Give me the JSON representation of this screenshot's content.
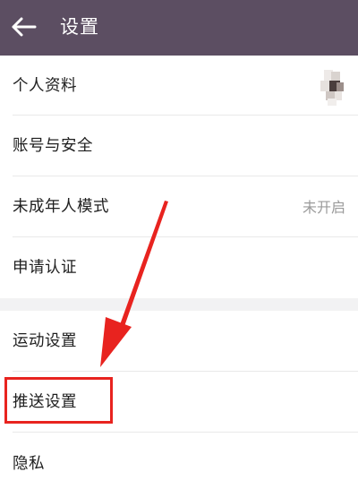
{
  "header": {
    "title": "设置",
    "back_icon": "arrow-left-icon",
    "background": "#5c4e62"
  },
  "menu": {
    "profile": {
      "label": "个人资料"
    },
    "account_security": {
      "label": "账号与安全"
    },
    "minor_mode": {
      "label": "未成年人模式",
      "value": "未开启"
    },
    "verification": {
      "label": "申请认证"
    },
    "sport_settings": {
      "label": "运动设置"
    },
    "push_settings": {
      "label": "推送设置"
    },
    "privacy": {
      "label": "隐私"
    }
  },
  "annotation": {
    "color": "#e8231f",
    "arrow_icon": "red-arrow-icon",
    "highlight_target": "推送设置"
  }
}
